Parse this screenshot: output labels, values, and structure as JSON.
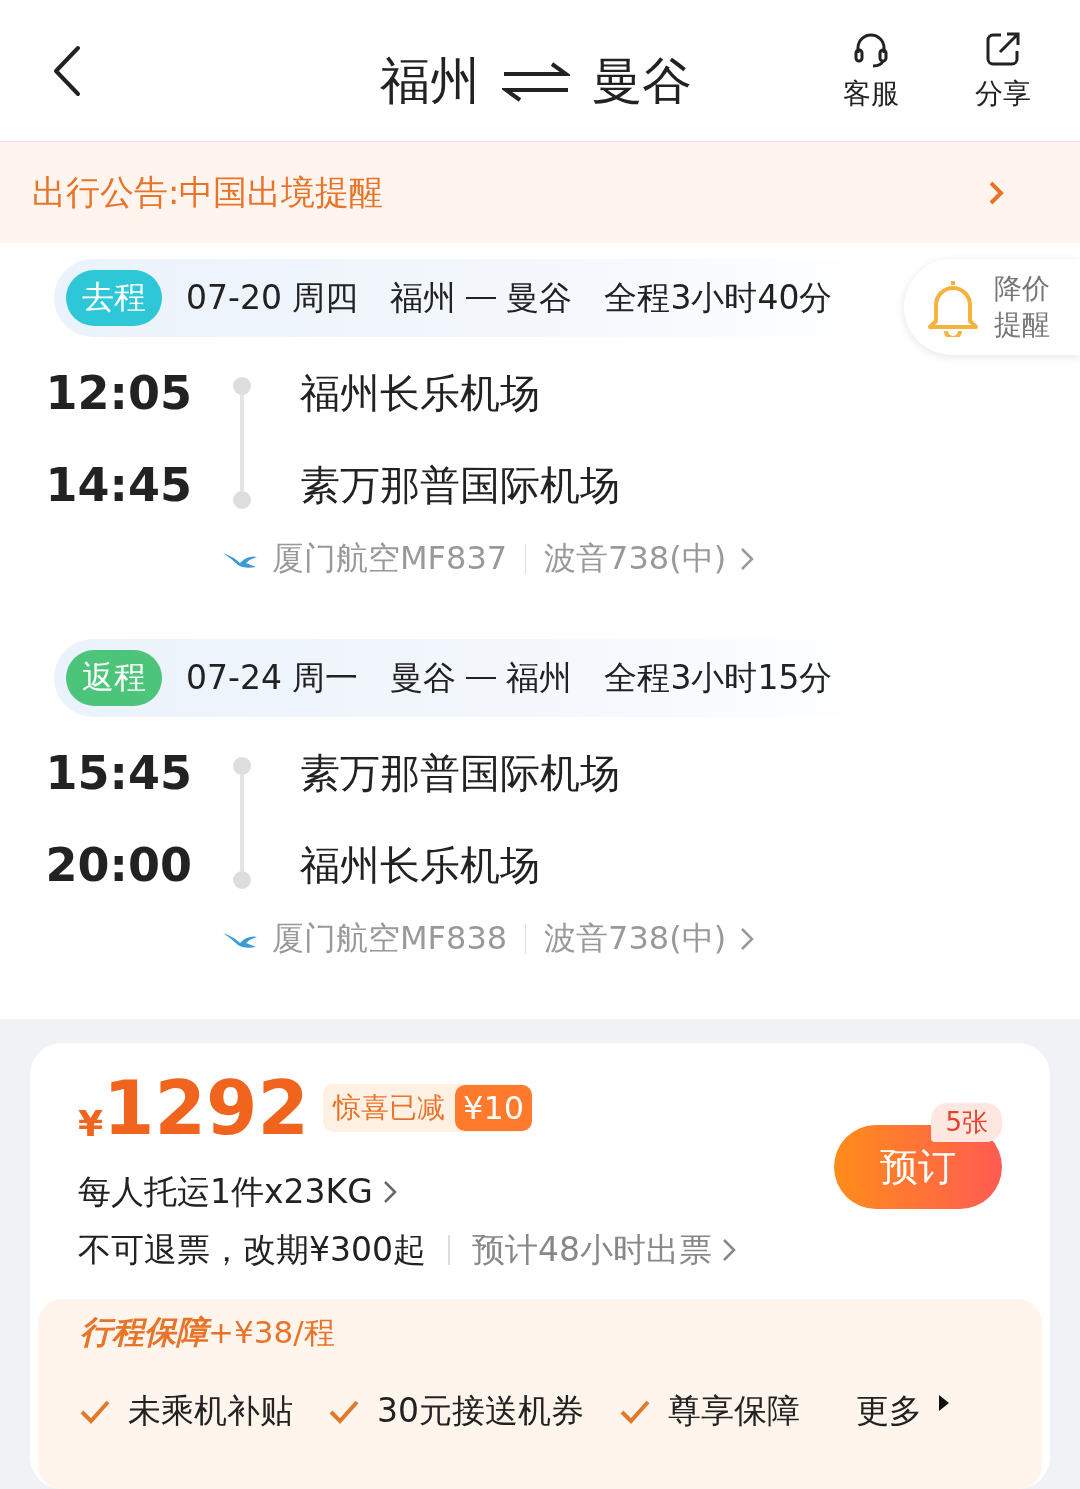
{
  "header": {
    "from": "福州",
    "to": "曼谷",
    "actions": [
      {
        "label": "客服",
        "kind": "headset"
      },
      {
        "label": "分享",
        "kind": "share"
      }
    ]
  },
  "notice": {
    "text": "出行公告:中国出境提醒"
  },
  "price_alert": {
    "lines": [
      "降价",
      "提醒"
    ]
  },
  "segments": [
    {
      "tag": "去程",
      "color": "#2ec7d8",
      "date": "07-20 周四",
      "route_from": "福州",
      "route_to": "曼谷",
      "duration": "全程3小时40分",
      "departure_time": "12:05",
      "departure_airport": "福州长乐机场",
      "arrival_time": "14:45",
      "arrival_airport": "素万那普国际机场",
      "flight": "厦门航空MF837",
      "aircraft": "波音738(中)"
    },
    {
      "tag": "返程",
      "color": "#4cc47a",
      "date": "07-24 周一",
      "route_from": "曼谷",
      "route_to": "福州",
      "duration": "全程3小时15分",
      "departure_time": "15:45",
      "departure_airport": "素万那普国际机场",
      "arrival_time": "20:00",
      "arrival_airport": "福州长乐机场",
      "flight": "厦门航空MF838",
      "aircraft": "波音738(中)"
    }
  ],
  "offer": {
    "currency": "¥",
    "price": "1292",
    "discount_label": "惊喜已减",
    "discount": "¥10",
    "baggage": "每人托运1件x23KG",
    "refund": "不可退票，改期¥300起",
    "ticketing": "预计48小时出票",
    "book_button": "预订",
    "stock": "5张",
    "insurance": {
      "title": "行程保障",
      "price": "+¥38/程",
      "benefits": [
        "未乘机补贴",
        "30元接送机券",
        "尊享保障"
      ],
      "more": "更多"
    }
  }
}
